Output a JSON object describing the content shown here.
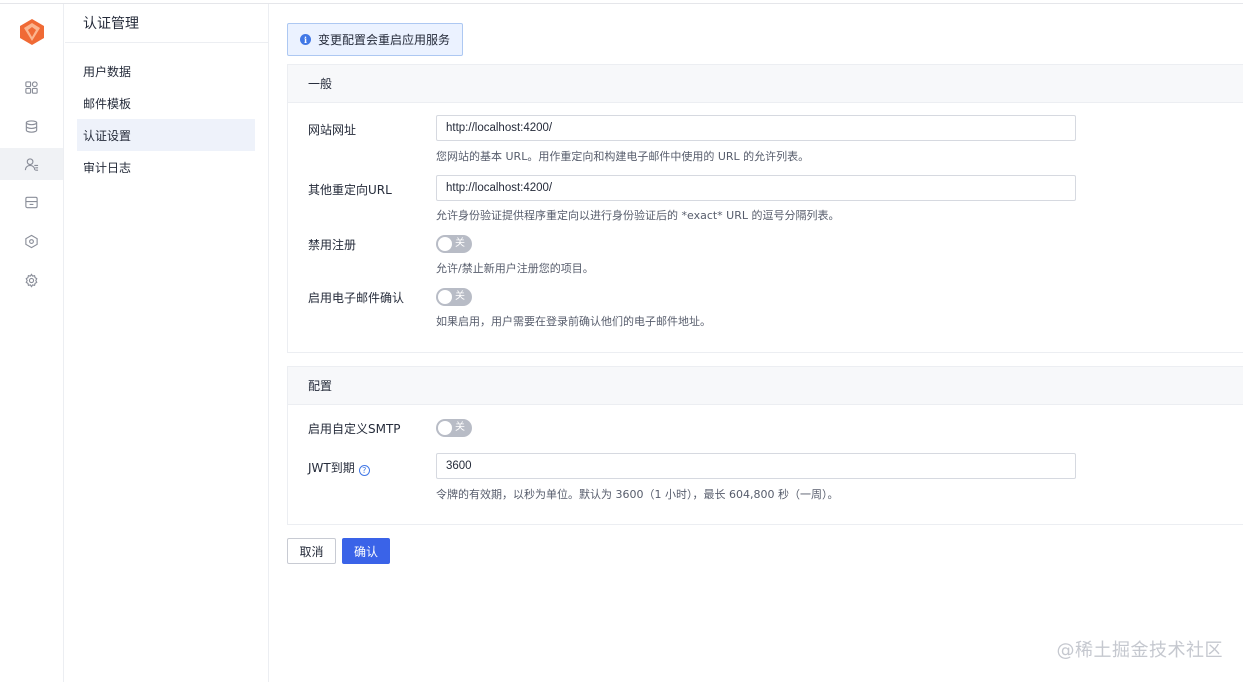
{
  "nav": {
    "title": "认证管理",
    "items": [
      {
        "label": "用户数据",
        "active": false
      },
      {
        "label": "邮件模板",
        "active": false
      },
      {
        "label": "认证设置",
        "active": true
      },
      {
        "label": "审计日志",
        "active": false
      }
    ]
  },
  "rail": {
    "icons": [
      "apps-icon",
      "database-icon",
      "user-auth-icon",
      "storage-icon",
      "extensions-icon",
      "settings-icon"
    ],
    "active_index": 2
  },
  "notice": {
    "icon": "info-icon",
    "text": "变更配置会重启应用服务"
  },
  "general": {
    "title": "一般",
    "site_url": {
      "label": "网站网址",
      "value": "http://localhost:4200/",
      "help": "您网站的基本 URL。用作重定向和构建电子邮件中使用的 URL 的允许列表。"
    },
    "redirect_url": {
      "label": "其他重定向URL",
      "value": "http://localhost:4200/",
      "help": "允许身份验证提供程序重定向以进行身份验证后的 *exact* URL 的逗号分隔列表。"
    },
    "disable_signup": {
      "label": "禁用注册",
      "state": "关",
      "help": "允许/禁止新用户注册您的项目。"
    },
    "email_confirm": {
      "label": "启用电子邮件确认",
      "state": "关",
      "help": "如果启用，用户需要在登录前确认他们的电子邮件地址。"
    }
  },
  "config": {
    "title": "配置",
    "smtp": {
      "label": "启用自定义SMTP",
      "state": "关"
    },
    "jwt": {
      "label": "JWT到期",
      "help_icon": "question-icon",
      "value": "3600",
      "help": "令牌的有效期，以秒为单位。默认为 3600（1 小时），最长 604,800 秒（一周）。"
    }
  },
  "actions": {
    "cancel": "取消",
    "confirm": "确认"
  },
  "watermark": "@稀土掘金技术社区",
  "colors": {
    "primary": "#3a63e8",
    "info": "#4178e6",
    "switch_off": "#b8bcc6",
    "logo": "#f06a35"
  }
}
